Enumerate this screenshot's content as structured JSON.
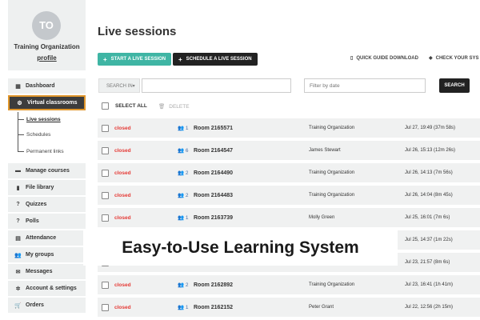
{
  "org": {
    "initials": "TO",
    "name": "Training Organization",
    "profile_link": "profile"
  },
  "nav": {
    "items": [
      {
        "label": "Dashboard",
        "icon": "▦",
        "icon_name": "dashboard-icon"
      },
      {
        "label": "Virtual classrooms",
        "icon": "⚙",
        "icon_name": "classroom-icon"
      },
      {
        "label": "Manage courses",
        "icon": "▬",
        "icon_name": "courses-icon"
      },
      {
        "label": "File library",
        "icon": "▮",
        "icon_name": "file-icon"
      },
      {
        "label": "Quizzes",
        "icon": "?",
        "icon_name": "quiz-icon"
      },
      {
        "label": "Polls",
        "icon": "?",
        "icon_name": "poll-icon"
      },
      {
        "label": "Attendance",
        "icon": "▤",
        "icon_name": "attendance-icon"
      },
      {
        "label": "My groups",
        "icon": "👥",
        "icon_name": "groups-icon"
      },
      {
        "label": "Messages",
        "icon": "✉",
        "icon_name": "messages-icon"
      },
      {
        "label": "Account & settings",
        "icon": "✲",
        "icon_name": "settings-icon"
      },
      {
        "label": "Orders",
        "icon": "🛒",
        "icon_name": "cart-icon"
      }
    ],
    "sub_items": [
      "Live sessions",
      "Schedules",
      "Permanent links"
    ],
    "active_color": "#e0962b"
  },
  "main": {
    "title": "Live sessions",
    "start_btn": "START A LIVE SESSION",
    "schedule_btn": "SCHEDULE A LIVE SESSION",
    "guide_link": "QUICK GUIDE DOWNLOAD",
    "check_link": "CHECK YOUR SYS",
    "search_in": "SEARCH IN▾",
    "filter_placeholder": "Filter by date",
    "search_btn": "SEARCH",
    "select_all": "SELECT ALL",
    "delete": "DELETE",
    "accent": "#3fb5a4"
  },
  "rows": [
    {
      "status": "closed",
      "users": "1",
      "room": "Room 2165571",
      "owner": "Training Organization",
      "date": "Jul 27, 19:49 (37m 58s)"
    },
    {
      "status": "closed",
      "users": "6",
      "room": "Room 2164547",
      "owner": "James Stewart",
      "date": "Jul 26, 15:13 (12m 26s)"
    },
    {
      "status": "closed",
      "users": "2",
      "room": "Room 2164490",
      "owner": "Training Organization",
      "date": "Jul 26, 14:13 (7m 56s)"
    },
    {
      "status": "closed",
      "users": "2",
      "room": "Room 2164483",
      "owner": "Training Organization",
      "date": "Jul 26, 14:04 (8m 45s)"
    },
    {
      "status": "closed",
      "users": "1",
      "room": "Room 2163739",
      "owner": "Molly Green",
      "date": "Jul 25, 16:01 (7m 6s)"
    },
    {
      "status": "",
      "users": "",
      "room": "",
      "owner": "",
      "date": "Jul 25, 14:37 (1m 22s)"
    },
    {
      "status": "",
      "users": "",
      "room": "",
      "owner": "",
      "date": "Jul 23, 21:57 (8m 6s)"
    },
    {
      "status": "closed",
      "users": "2",
      "room": "Room 2162892",
      "owner": "Training Organization",
      "date": "Jul 23, 16:41 (1h 41m)"
    },
    {
      "status": "closed",
      "users": "1",
      "room": "Room 2162152",
      "owner": "Peter Grant",
      "date": "Jul 22, 12:56 (2h 15m)"
    }
  ],
  "overlay_text": "Easy-to-Use Learning System"
}
